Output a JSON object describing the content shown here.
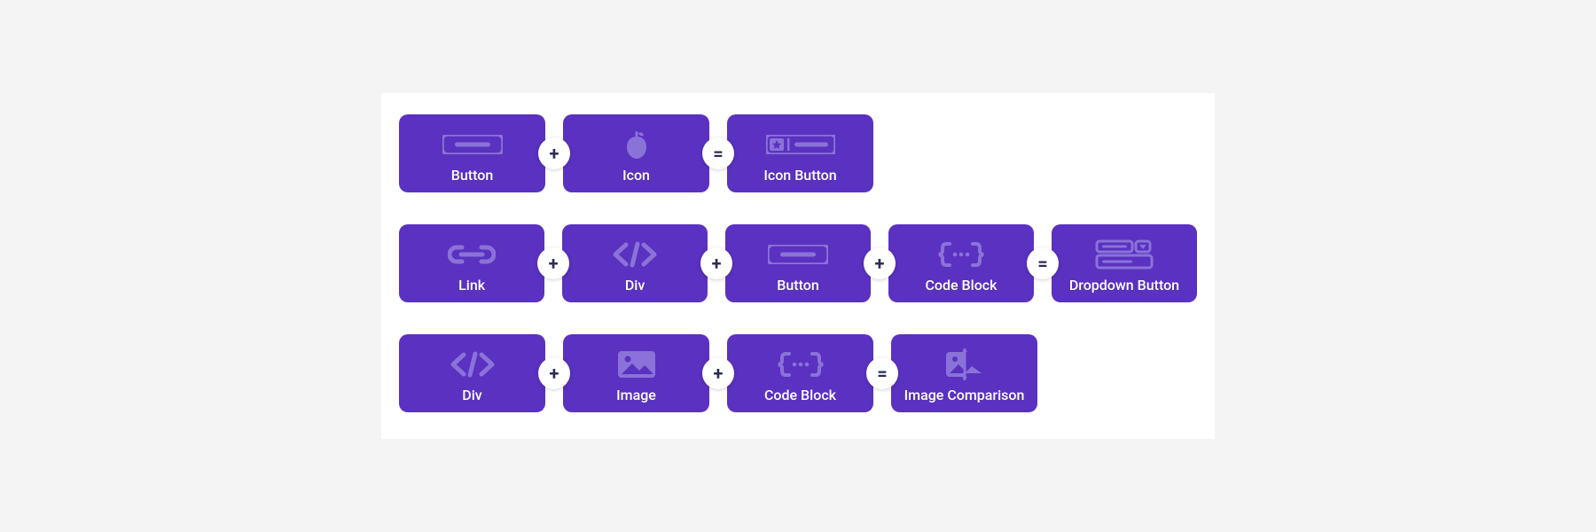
{
  "rows": [
    {
      "tiles": [
        {
          "label": "Button",
          "op": "+",
          "icon": "button"
        },
        {
          "label": "Icon",
          "op": "=",
          "icon": "apple"
        },
        {
          "label": "Icon Button",
          "op": null,
          "icon": "icon-button"
        }
      ]
    },
    {
      "tiles": [
        {
          "label": "Link",
          "op": "+",
          "icon": "link"
        },
        {
          "label": "Div",
          "op": "+",
          "icon": "code"
        },
        {
          "label": "Button",
          "op": "+",
          "icon": "button"
        },
        {
          "label": "Code Block",
          "op": "=",
          "icon": "codeblock"
        },
        {
          "label": "Dropdown Button",
          "op": null,
          "icon": "dropdown"
        }
      ]
    },
    {
      "tiles": [
        {
          "label": "Div",
          "op": "+",
          "icon": "code"
        },
        {
          "label": "Image",
          "op": "+",
          "icon": "image"
        },
        {
          "label": "Code Block",
          "op": "=",
          "icon": "codeblock"
        },
        {
          "label": "Image Comparison",
          "op": null,
          "icon": "image-compare"
        }
      ]
    }
  ],
  "colors": {
    "tile": "#5A31C0",
    "glyph": "#8B72D8"
  }
}
